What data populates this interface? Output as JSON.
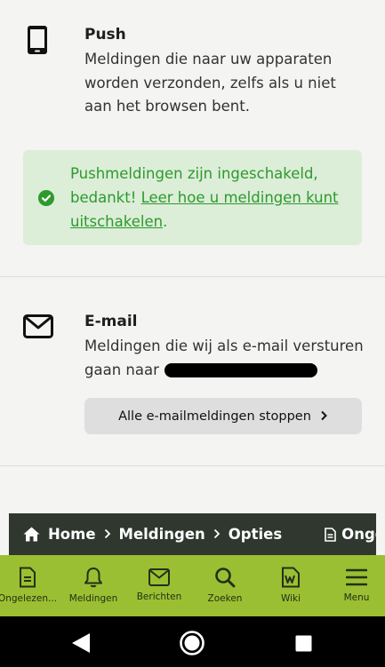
{
  "push": {
    "title": "Push",
    "description": "Meldingen die naar uw apparaten worden verzonden, zelfs als u niet aan het browsen bent.",
    "alert": {
      "text": "Pushmeldingen zijn ingeschakeld, bedankt! ",
      "link": "Leer hoe u meldingen kunt uitschakelen",
      "suffix": "."
    }
  },
  "email": {
    "title": "E-mail",
    "description": "Meldingen die wij als e-mail versturen gaan naar",
    "stop_button": "Alle e-mailmeldingen stoppen"
  },
  "breadcrumb": {
    "items": [
      "Home",
      "Meldingen",
      "Opties"
    ],
    "unread": "Ongelezen"
  },
  "bottom_nav": {
    "items": [
      {
        "label": "Ongelezen...",
        "icon": "document-icon"
      },
      {
        "label": "Meldingen",
        "icon": "bell-icon"
      },
      {
        "label": "Berichten",
        "icon": "envelope-icon"
      },
      {
        "label": "Zoeken",
        "icon": "search-icon"
      },
      {
        "label": "Wiki",
        "icon": "wiki-icon"
      },
      {
        "label": "Menu",
        "icon": "menu-icon"
      }
    ]
  },
  "colors": {
    "accent_green": "#9bbf32",
    "success_text": "#2d9a2d",
    "success_bg": "#dcedd8",
    "breadcrumb_bg": "#2f372f"
  }
}
